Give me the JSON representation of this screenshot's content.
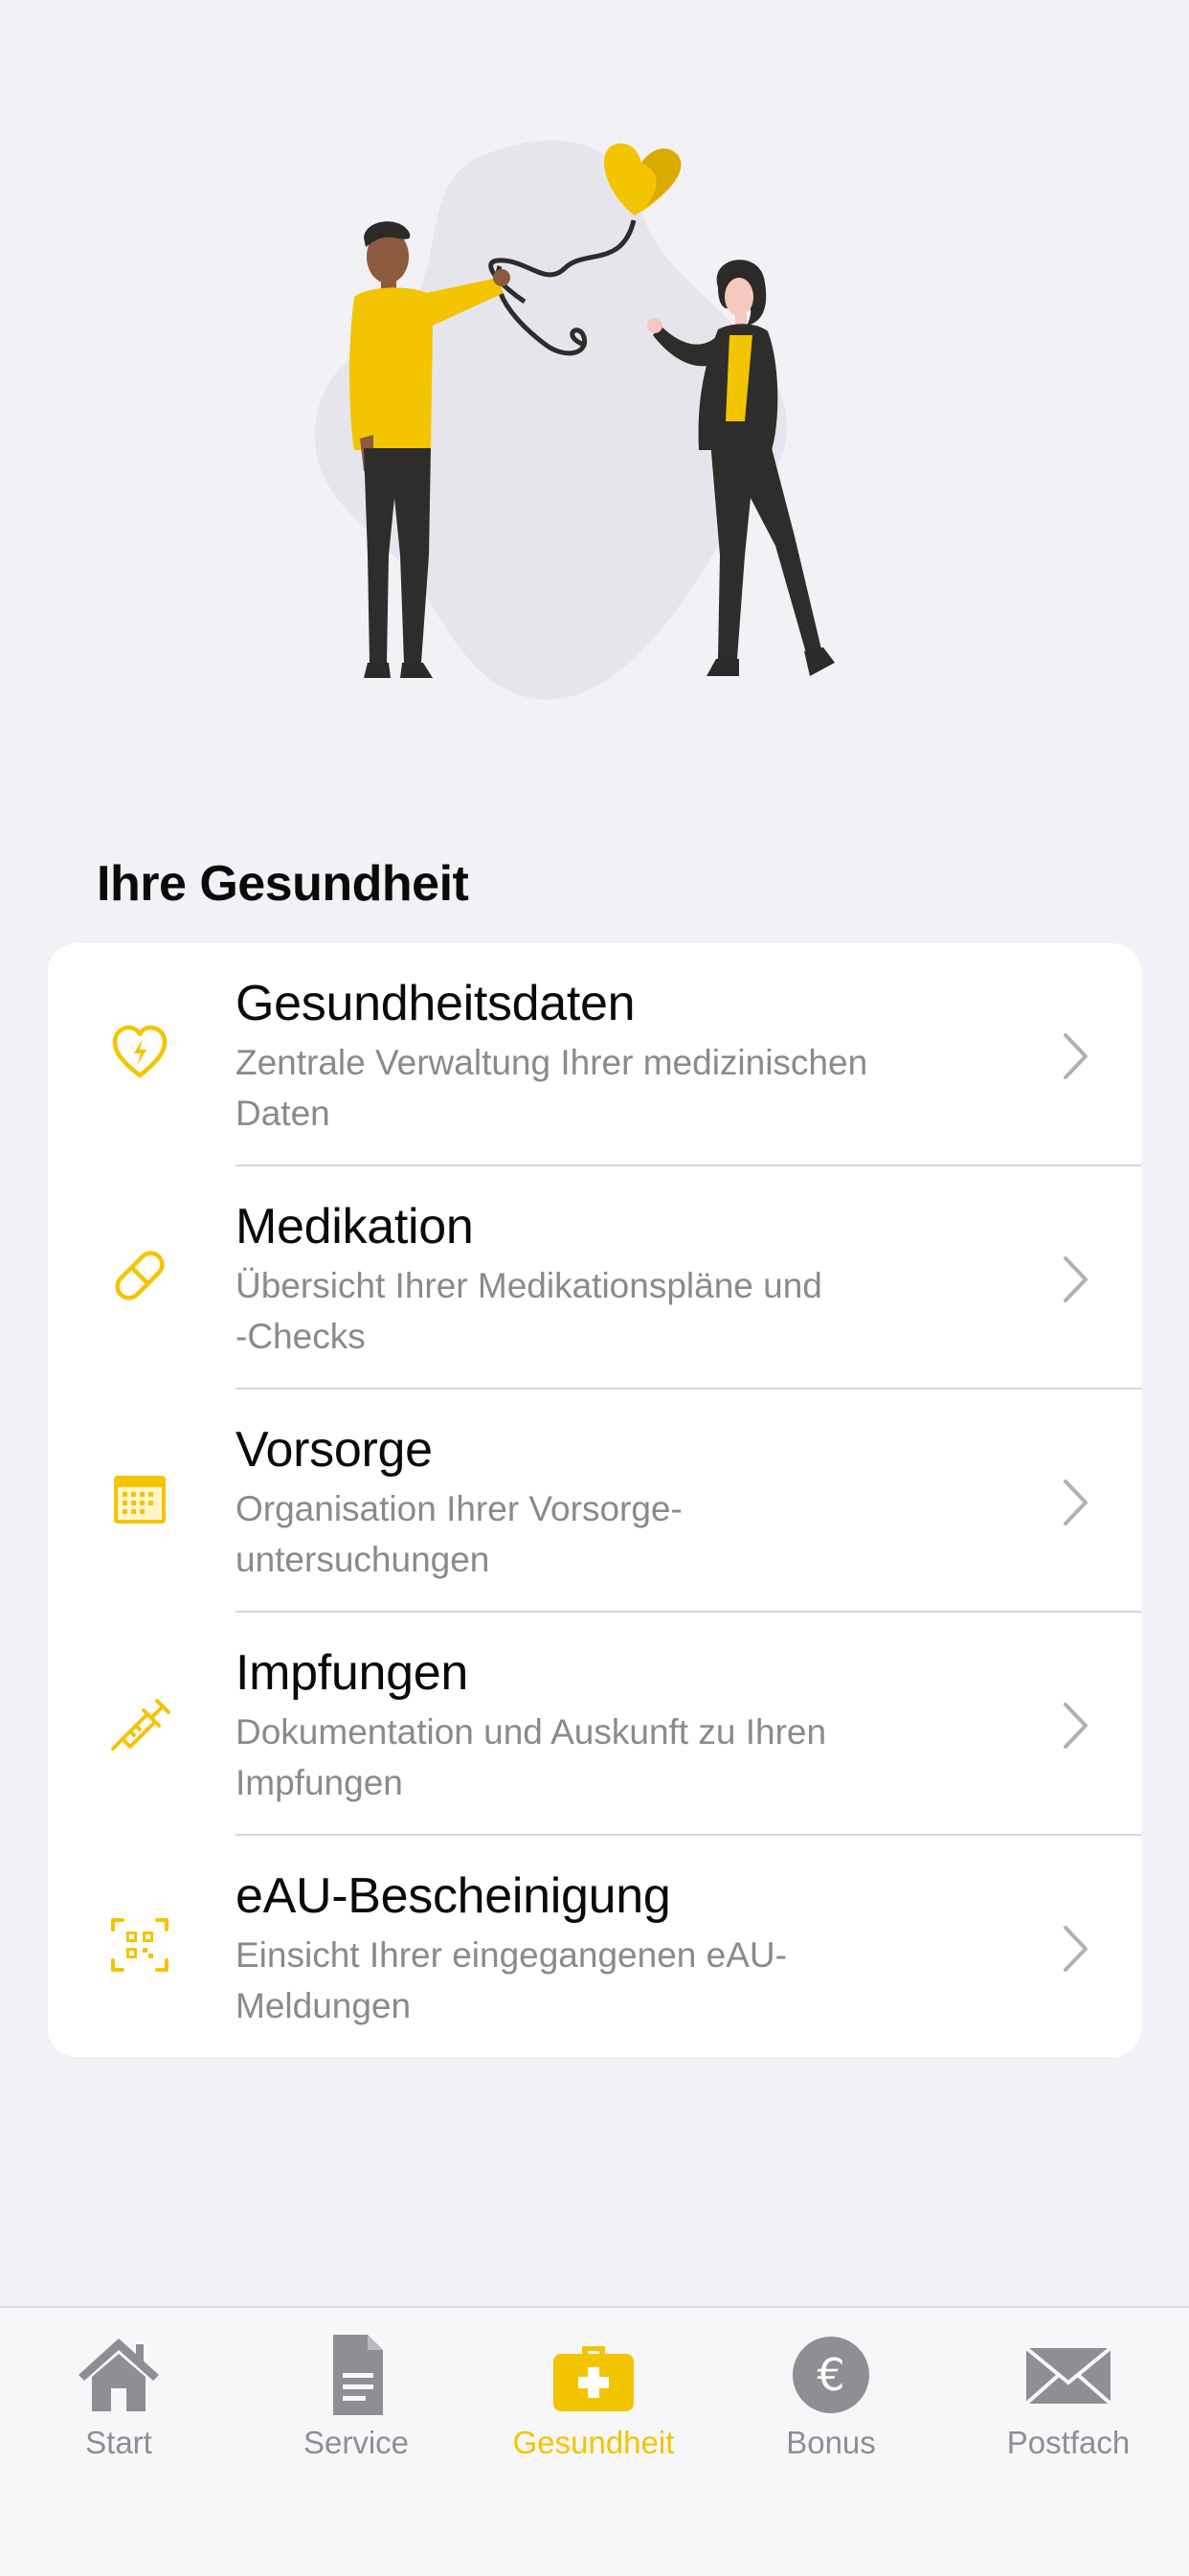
{
  "section": {
    "title": "Ihre Gesundheit"
  },
  "items": [
    {
      "title": "Gesundheitsdaten",
      "subtitle_line1": "Zentrale Verwaltung Ihrer medizinischen",
      "subtitle_line2": "Daten",
      "icon": "heart-pulse-icon"
    },
    {
      "title": "Medikation",
      "subtitle_line1": "Übersicht Ihrer Medikationspläne und",
      "subtitle_line2": "-Checks",
      "icon": "pill-icon"
    },
    {
      "title": "Vorsorge",
      "subtitle_line1": "Organisation Ihrer Vorsorge-",
      "subtitle_line2": "untersuchungen",
      "icon": "calendar-icon"
    },
    {
      "title": "Impfungen",
      "subtitle_line1": "Dokumentation und Auskunft zu Ihren",
      "subtitle_line2": "Impfungen",
      "icon": "syringe-icon"
    },
    {
      "title": "eAU-Bescheinigung",
      "subtitle_line1": "Einsicht Ihrer eingegangenen eAU-",
      "subtitle_line2": "Meldungen",
      "icon": "qr-scan-icon"
    }
  ],
  "tabs": [
    {
      "label": "Start",
      "icon": "house-icon",
      "active": false
    },
    {
      "label": "Service",
      "icon": "document-icon",
      "active": false
    },
    {
      "label": "Gesundheit",
      "icon": "medical-case-icon",
      "active": true
    },
    {
      "label": "Bonus",
      "icon": "euro-coin-icon",
      "active": false
    },
    {
      "label": "Postfach",
      "icon": "envelope-icon",
      "active": false
    }
  ],
  "colors": {
    "accent": "#f3c400",
    "background": "#f2f1f6",
    "inactive": "#8e8e93"
  }
}
